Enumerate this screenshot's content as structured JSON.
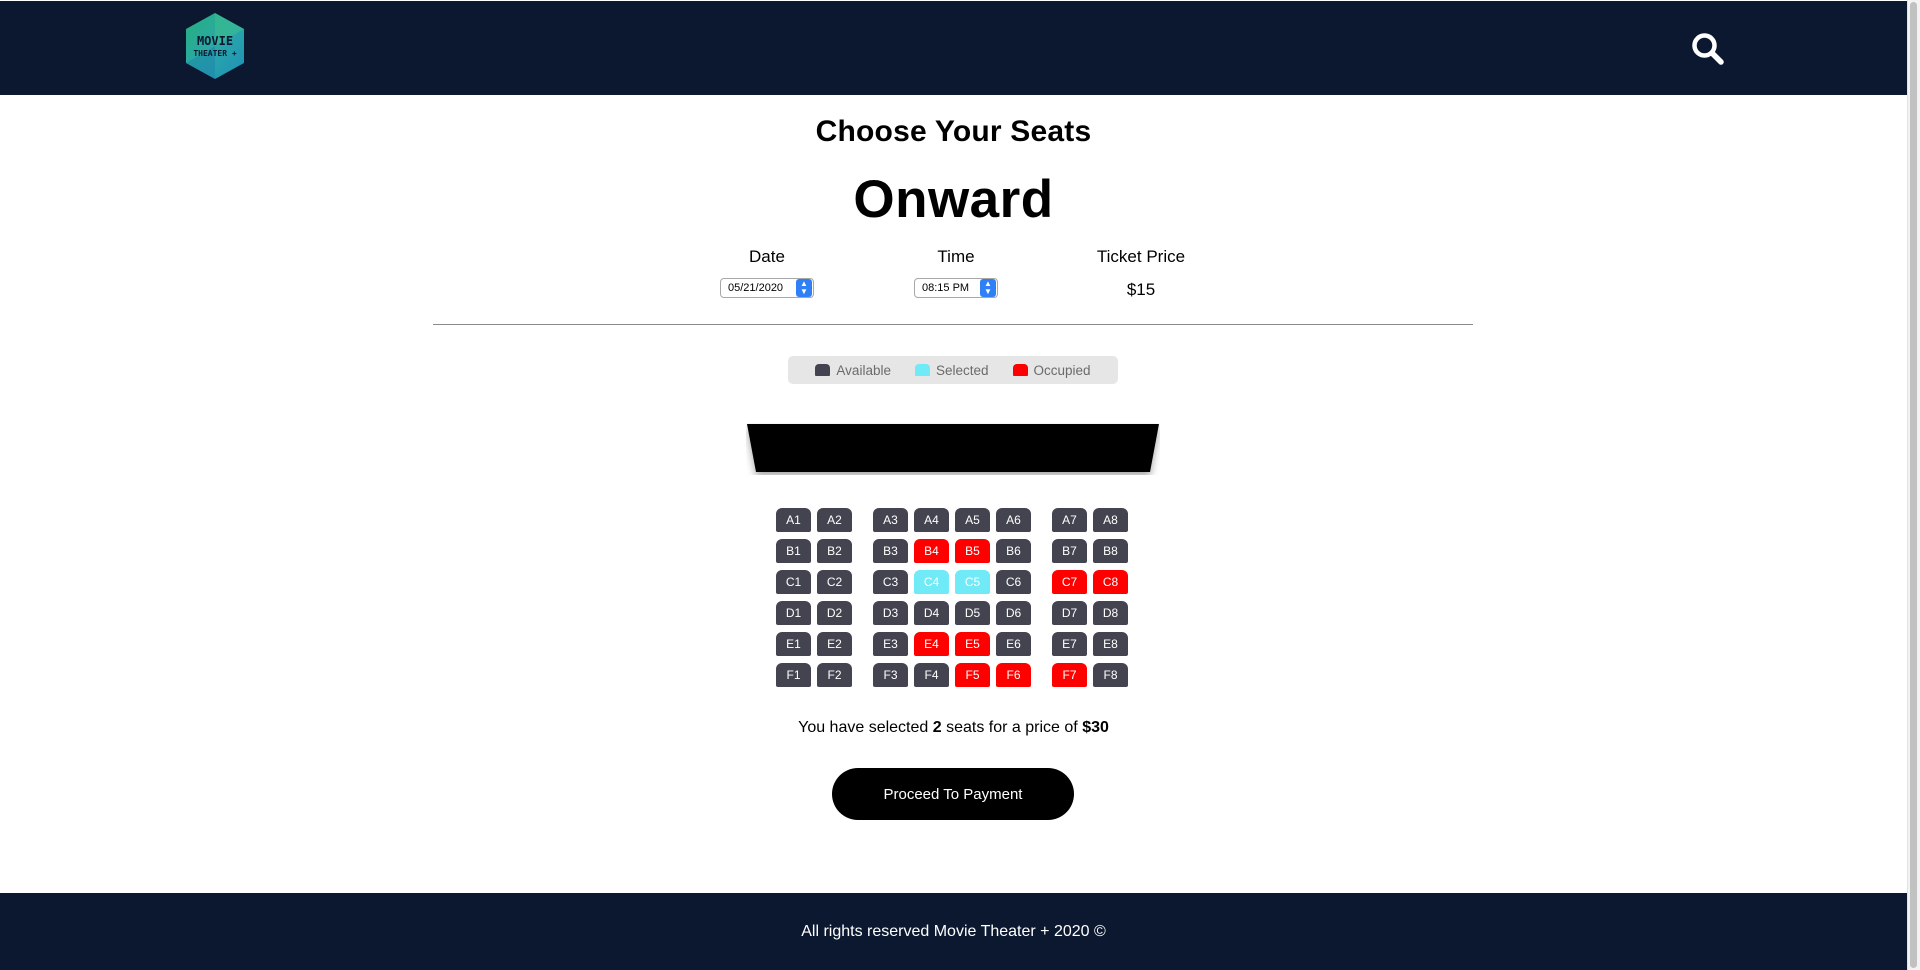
{
  "header": {
    "logo_line1": "MOVIE",
    "logo_line2": "THEATER +",
    "search_icon": "search-icon",
    "background_color": "#0b1830"
  },
  "main": {
    "heading": "Choose Your Seats",
    "movie_title": "Onward",
    "date": {
      "label": "Date",
      "value": "05/21/2020"
    },
    "time": {
      "label": "Time",
      "value": "08:15 PM"
    },
    "ticket_price": {
      "label": "Ticket Price",
      "value": "$15"
    }
  },
  "legend": {
    "available_label": "Available",
    "selected_label": "Selected",
    "occupied_label": "Occupied"
  },
  "colors": {
    "available": "#444451",
    "selected": "#6feaf6",
    "occupied": "#ff0000"
  },
  "seats": {
    "rows": [
      {
        "row": "A",
        "seats": [
          {
            "id": "A1",
            "status": "available"
          },
          {
            "id": "A2",
            "status": "available"
          },
          {
            "id": "A3",
            "status": "available"
          },
          {
            "id": "A4",
            "status": "available"
          },
          {
            "id": "A5",
            "status": "available"
          },
          {
            "id": "A6",
            "status": "available"
          },
          {
            "id": "A7",
            "status": "available"
          },
          {
            "id": "A8",
            "status": "available"
          }
        ]
      },
      {
        "row": "B",
        "seats": [
          {
            "id": "B1",
            "status": "available"
          },
          {
            "id": "B2",
            "status": "available"
          },
          {
            "id": "B3",
            "status": "available"
          },
          {
            "id": "B4",
            "status": "occupied"
          },
          {
            "id": "B5",
            "status": "occupied"
          },
          {
            "id": "B6",
            "status": "available"
          },
          {
            "id": "B7",
            "status": "available"
          },
          {
            "id": "B8",
            "status": "available"
          }
        ]
      },
      {
        "row": "C",
        "seats": [
          {
            "id": "C1",
            "status": "available"
          },
          {
            "id": "C2",
            "status": "available"
          },
          {
            "id": "C3",
            "status": "available"
          },
          {
            "id": "C4",
            "status": "selected"
          },
          {
            "id": "C5",
            "status": "selected"
          },
          {
            "id": "C6",
            "status": "available"
          },
          {
            "id": "C7",
            "status": "occupied"
          },
          {
            "id": "C8",
            "status": "occupied"
          }
        ]
      },
      {
        "row": "D",
        "seats": [
          {
            "id": "D1",
            "status": "available"
          },
          {
            "id": "D2",
            "status": "available"
          },
          {
            "id": "D3",
            "status": "available"
          },
          {
            "id": "D4",
            "status": "available"
          },
          {
            "id": "D5",
            "status": "available"
          },
          {
            "id": "D6",
            "status": "available"
          },
          {
            "id": "D7",
            "status": "available"
          },
          {
            "id": "D8",
            "status": "available"
          }
        ]
      },
      {
        "row": "E",
        "seats": [
          {
            "id": "E1",
            "status": "available"
          },
          {
            "id": "E2",
            "status": "available"
          },
          {
            "id": "E3",
            "status": "available"
          },
          {
            "id": "E4",
            "status": "occupied"
          },
          {
            "id": "E5",
            "status": "occupied"
          },
          {
            "id": "E6",
            "status": "available"
          },
          {
            "id": "E7",
            "status": "available"
          },
          {
            "id": "E8",
            "status": "available"
          }
        ]
      },
      {
        "row": "F",
        "seats": [
          {
            "id": "F1",
            "status": "available"
          },
          {
            "id": "F2",
            "status": "available"
          },
          {
            "id": "F3",
            "status": "available"
          },
          {
            "id": "F4",
            "status": "available"
          },
          {
            "id": "F5",
            "status": "occupied"
          },
          {
            "id": "F6",
            "status": "occupied"
          },
          {
            "id": "F7",
            "status": "occupied"
          },
          {
            "id": "F8",
            "status": "available"
          }
        ]
      }
    ]
  },
  "summary": {
    "prefix": "You have selected",
    "count": "2",
    "middle": "seats for a price of",
    "total": "$30"
  },
  "actions": {
    "proceed_label": "Proceed To Payment"
  },
  "footer": {
    "text": "All rights reserved Movie Theater + 2020 ©"
  }
}
